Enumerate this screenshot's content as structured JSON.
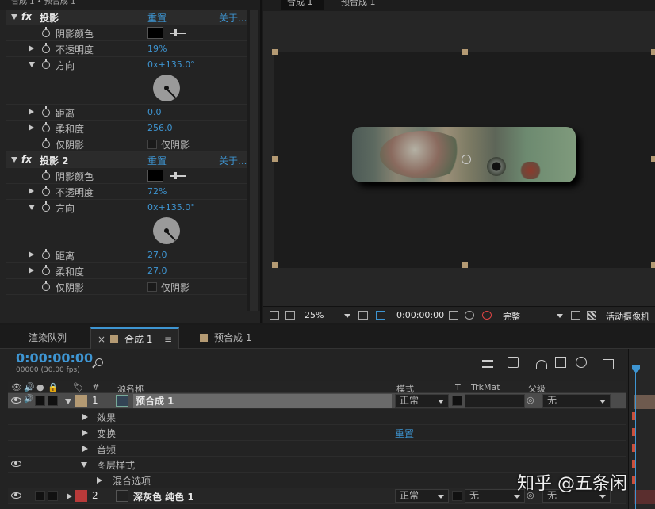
{
  "effect_controls": {
    "title": "合成 1 • 预合成 1",
    "drop_shadow_1": {
      "name": "投影",
      "reset": "重置",
      "about": "关于...",
      "shadow_color_label": "阴影颜色",
      "opacity_label": "不透明度",
      "opacity_value": "19%",
      "direction_label": "方向",
      "direction_value": "0x+135.0°",
      "distance_label": "距离",
      "distance_value": "0.0",
      "softness_label": "柔和度",
      "softness_value": "256.0",
      "shadow_only_label": "仅阴影",
      "shadow_only_value": "仅阴影"
    },
    "drop_shadow_2": {
      "name": "投影 2",
      "reset": "重置",
      "about": "关于...",
      "shadow_color_label": "阴影颜色",
      "opacity_label": "不透明度",
      "opacity_value": "72%",
      "direction_label": "方向",
      "direction_value": "0x+135.0°",
      "distance_label": "距离",
      "distance_value": "27.0",
      "softness_label": "柔和度",
      "softness_value": "27.0",
      "shadow_only_label": "仅阴影",
      "shadow_only_value": "仅阴影"
    }
  },
  "composition": {
    "tabs": [
      "合成 1",
      "预合成 1"
    ],
    "toolbar": {
      "zoom": "25%",
      "timecode": "0:00:00:00",
      "quality": "完整",
      "camera": "活动摄像机"
    }
  },
  "timeline": {
    "tabs": {
      "render_queue": "渲染队列",
      "close": "×",
      "comp1": "合成 1",
      "menu": "≡",
      "precomp1": "预合成 1"
    },
    "timecode": "0:00:00:00",
    "fps": "00000 (30.00 fps)",
    "columns": {
      "num": "#",
      "source": "源名称",
      "mode": "模式",
      "t": "T",
      "trkmat": "TrkMat",
      "parent": "父级"
    },
    "layers": [
      {
        "num": "1",
        "name": "预合成 1",
        "mode": "正常",
        "trkmat": "",
        "parent": "无"
      },
      {
        "num": "2",
        "name": "深灰色 纯色 1",
        "mode": "正常",
        "trkmat": "无",
        "parent": "无"
      }
    ],
    "properties": {
      "effects": "效果",
      "transform": "变换",
      "transform_reset": "重置",
      "audio": "音频",
      "layer_styles": "图层样式",
      "blend_options": "混合选项"
    }
  },
  "watermark": "知乎 @五条闲",
  "colors": {
    "accent": "#3e95d2",
    "label_tan": "#b49a73",
    "label_red": "#b83a3a"
  }
}
